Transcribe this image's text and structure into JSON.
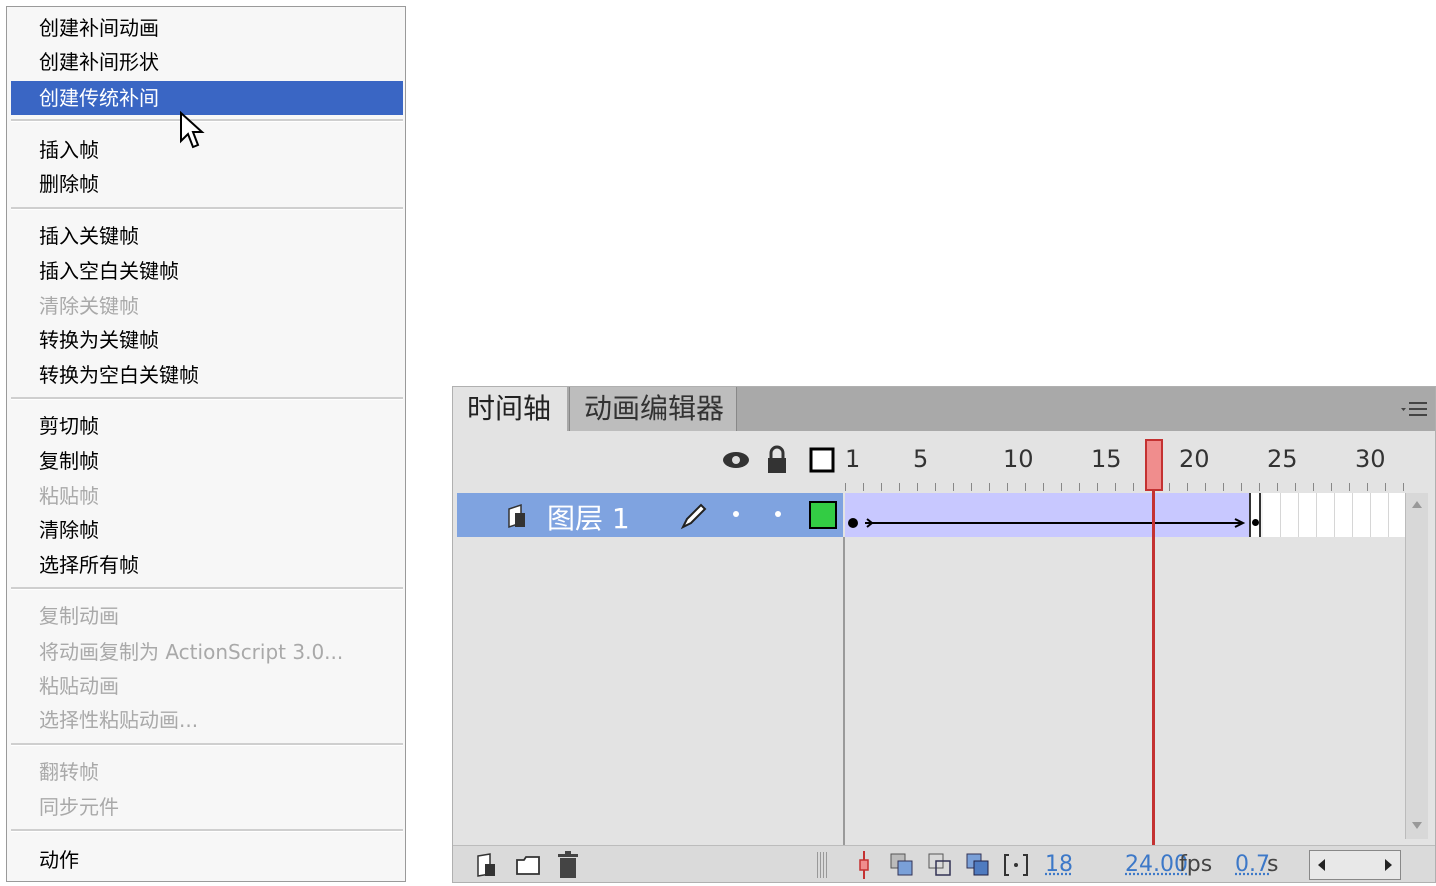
{
  "context_menu": {
    "items": [
      {
        "label": "创建补间动画",
        "enabled": true
      },
      {
        "label": "创建补间形状",
        "enabled": true
      },
      {
        "label": "创建传统补间",
        "enabled": true,
        "highlighted": true
      },
      {
        "label": "插入帧",
        "enabled": true
      },
      {
        "label": "删除帧",
        "enabled": true
      },
      {
        "label": "插入关键帧",
        "enabled": true
      },
      {
        "label": "插入空白关键帧",
        "enabled": true
      },
      {
        "label": "清除关键帧",
        "enabled": false
      },
      {
        "label": "转换为关键帧",
        "enabled": true
      },
      {
        "label": "转换为空白关键帧",
        "enabled": true
      },
      {
        "label": "剪切帧",
        "enabled": true
      },
      {
        "label": "复制帧",
        "enabled": true
      },
      {
        "label": "粘贴帧",
        "enabled": false
      },
      {
        "label": "清除帧",
        "enabled": true
      },
      {
        "label": "选择所有帧",
        "enabled": true
      },
      {
        "label": "复制动画",
        "enabled": false
      },
      {
        "label": "将动画复制为 ActionScript 3.0...",
        "enabled": false
      },
      {
        "label": "粘贴动画",
        "enabled": false
      },
      {
        "label": "选择性粘贴动画...",
        "enabled": false
      },
      {
        "label": "翻转帧",
        "enabled": false
      },
      {
        "label": "同步元件",
        "enabled": false
      },
      {
        "label": "动作",
        "enabled": true
      }
    ]
  },
  "timeline": {
    "tabs": [
      {
        "label": "时间轴",
        "active": true
      },
      {
        "label": "动画编辑器",
        "active": false
      }
    ],
    "frame_numbers": [
      "1",
      "5",
      "10",
      "15",
      "20",
      "25",
      "30"
    ],
    "layer": {
      "name": "图层 1",
      "color": "#33cc44"
    },
    "current_frame": "18",
    "fps_value": "24.00",
    "fps_unit": "fps",
    "time_value": "0.7",
    "time_unit": "s"
  },
  "colors": {
    "menu_highlight": "#3a66c4",
    "layer_selected": "#7fa3e0",
    "tween_band": "#c8c8ff",
    "playhead": "#c43232"
  }
}
